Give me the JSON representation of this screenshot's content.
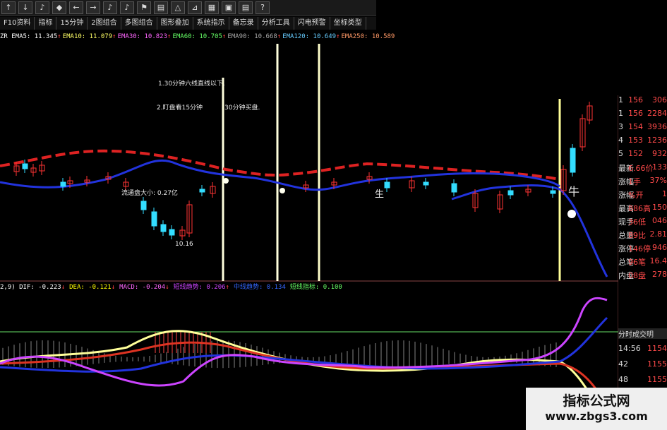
{
  "toolbar": {
    "icons": [
      "arrow-up-icon",
      "arrow-down-icon",
      "bell-icon",
      "diamond-icon",
      "arrow-left-icon",
      "arrow-right-icon",
      "bell-icon",
      "bell-icon",
      "flag-icon",
      "chart-icon",
      "triangle-icon",
      "ruler-icon",
      "document-icon",
      "window-icon",
      "chart-icon",
      "question-icon"
    ]
  },
  "tabs": [
    "F10资料",
    "指标",
    "15分钟",
    "2图组合",
    "多图组合",
    "图形叠加",
    "系统指示",
    "备忘录",
    "分析工具",
    "闪电预警",
    "坐标类型"
  ],
  "ema_line": [
    {
      "label": "ZR EMA5: 11.345",
      "arrow": "↑",
      "color": "#ffffff"
    },
    {
      "label": "EMA10: 11.079",
      "arrow": "↑",
      "color": "#ffff66"
    },
    {
      "label": "EMA30: 10.823",
      "arrow": "↑",
      "color": "#ff66ff"
    },
    {
      "label": "EMA60: 10.705",
      "arrow": "↑",
      "color": "#66ff66"
    },
    {
      "label": "EMA90: 10.668",
      "arrow": "↑",
      "color": "#aaaaaa"
    },
    {
      "label": "EMA120: 10.649",
      "arrow": "↑",
      "color": "#66ccff"
    },
    {
      "label": "EMA250: 10.589",
      "arrow": "",
      "color": "#ff9966"
    }
  ],
  "notes": {
    "note1": "1.30分钟六线直线以下.",
    "note2": "2.盯盘看15分钟",
    "note3": "30分钟买盘.",
    "flow": "流通盘大小: 0.27亿",
    "low_price": "10.16",
    "sheng1": "生",
    "niu": "牛"
  },
  "right_panel": {
    "rows": [
      {
        "label": "1",
        "val": "156",
        "val2": "306"
      },
      {
        "label": "1",
        "val": "156",
        "val2": "2284"
      },
      {
        "label": "3",
        "val": "154",
        "val2": "3936"
      },
      {
        "label": "4",
        "val": "153",
        "val2": "1236"
      },
      {
        "label": "5",
        "val": "152",
        "val2": "932"
      },
      {
        "label": "最新",
        "val": "6.66价",
        "val2": "133"
      },
      {
        "label": "涨幅",
        "val": "1手",
        "val2": "37%"
      },
      {
        "label": "涨幅",
        "val": "%开",
        "val2": "1"
      },
      {
        "label": "最高",
        "val": "886高",
        "val2": "150"
      },
      {
        "label": "现手",
        "val": "36低",
        "val2": "046"
      },
      {
        "label": "总量",
        "val": "89比",
        "val2": "2.81"
      },
      {
        "label": "涨停",
        "val": "146停",
        "val2": "946"
      },
      {
        "label": "总笔",
        "val": "96笔",
        "val2": "16.4"
      },
      {
        "label": "内盘",
        "val": "08盘",
        "val2": "278"
      }
    ],
    "trade_header": "分时成交明",
    "trades": [
      {
        "time": "14:56",
        "price": "1154"
      },
      {
        "time": "42",
        "price": "1155"
      },
      {
        "time": "48",
        "price": "1155"
      }
    ]
  },
  "macd_line": [
    {
      "label": "2,9) DIF: -0.223",
      "arrow": "↓",
      "color": "#ffffff"
    },
    {
      "label": "DEA: -0.121",
      "arrow": "↓",
      "color": "#ffff00"
    },
    {
      "label": "MACD: -0.204",
      "arrow": "↓",
      "color": "#ff66ff"
    },
    {
      "label": "短线趋势: 0.206",
      "arrow": "↑",
      "color": "#cc44ff"
    },
    {
      "label": "中线趋势: 0.134",
      "arrow": "",
      "color": "#3366ff"
    },
    {
      "label": "短线指标: 0.100",
      "arrow": "",
      "color": "#66ff66"
    }
  ],
  "watermark": {
    "line1": "指标公式网",
    "line2": "www.zbgs3.com"
  },
  "colors": {
    "up": "#ff3333",
    "down": "#33ddff",
    "ema_red": "#dd2222",
    "ema_blue": "#2233dd",
    "yellow_line": "#ffff99",
    "magenta": "#cc44ff",
    "green_line": "#66dd66"
  }
}
